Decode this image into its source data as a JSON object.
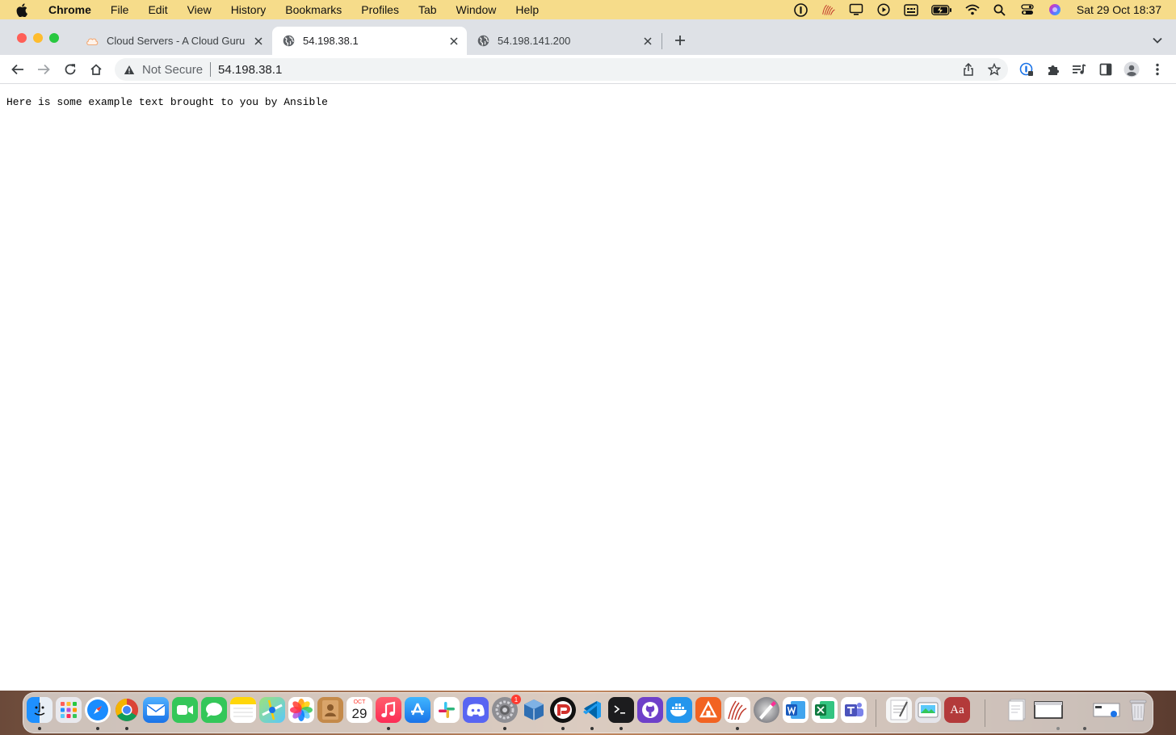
{
  "menubar": {
    "app_name": "Chrome",
    "menus": [
      "File",
      "Edit",
      "View",
      "History",
      "Bookmarks",
      "Profiles",
      "Tab",
      "Window",
      "Help"
    ],
    "clock": "Sat 29 Oct  18:37",
    "status_icons": [
      "onepassword-icon",
      "squiggle-app-icon",
      "display-icon",
      "play-circle-icon",
      "keyboard-input-icon",
      "battery-charging-icon",
      "wifi-icon",
      "spotlight-search-icon",
      "control-center-icon",
      "siri-icon"
    ]
  },
  "tabs": [
    {
      "title": "Cloud Servers - A Cloud Guru",
      "favicon": "cloud-icon",
      "active": false
    },
    {
      "title": "54.198.38.1",
      "favicon": "globe-icon",
      "active": true
    },
    {
      "title": "54.198.141.200",
      "favicon": "globe-icon",
      "active": false
    }
  ],
  "omnibox": {
    "security_label": "Not Secure",
    "url": "54.198.38.1"
  },
  "page": {
    "text": "Here is some example text brought to you by Ansible"
  },
  "dock": {
    "calendar_month": "OCT",
    "calendar_day": "29",
    "dictionary_label": "Aa",
    "settings_badge": "1"
  },
  "colors": {
    "menubar_bg": "#f6dc8a",
    "tabstrip_bg": "#dee1e6",
    "omnibox_bg": "#f1f3f4",
    "close_red": "#ff5f57",
    "minimize_yellow": "#febc2e",
    "zoom_green": "#28c840"
  }
}
